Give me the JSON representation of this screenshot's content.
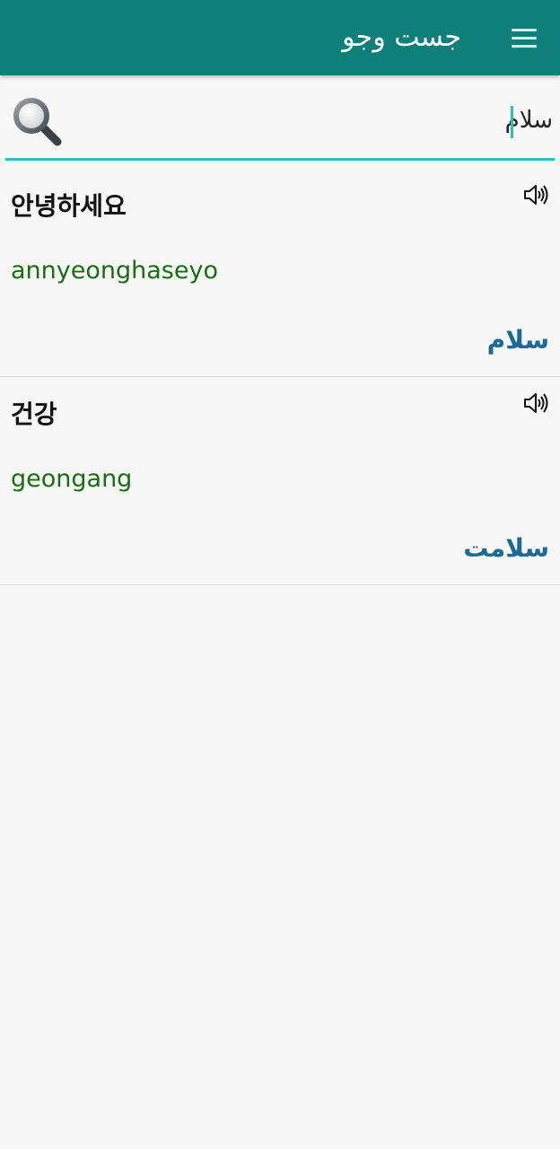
{
  "app_bar": {
    "title": "جست وجو",
    "menu_icon": "hamburger-menu-icon"
  },
  "search": {
    "value": "سلام",
    "icon": "magnifier-search-icon"
  },
  "results": [
    {
      "korean": "안녕하세요",
      "romanization": "annyeonghaseyo",
      "persian": "سلام",
      "icon": "speaker-icon"
    },
    {
      "korean": "건강",
      "romanization": "geongang",
      "persian": "سلامت",
      "icon": "speaker-icon"
    }
  ],
  "colors": {
    "app_bar": "#0f7f7a",
    "accent": "#2cc1b8",
    "romanization": "#1a6e12",
    "persian": "#1c6a96"
  }
}
